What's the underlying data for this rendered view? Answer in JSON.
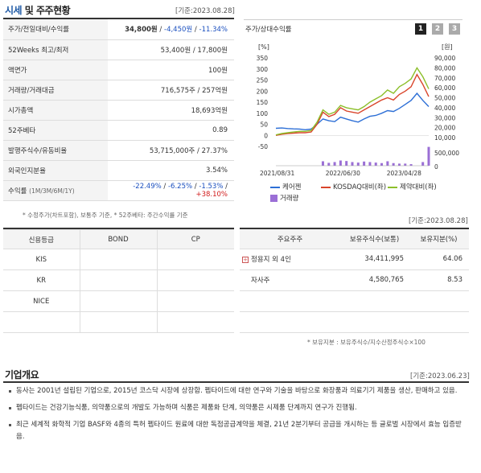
{
  "section1": {
    "title_accent": "시세",
    "title_rest": " 및 주주현황",
    "ref_date": "[기준:2023.08.28]"
  },
  "info": {
    "rows": [
      {
        "label": "주가/전일대비/수익률"
      },
      {
        "label": "52Weeks 최고/최저",
        "value": "53,400원 / 17,800원"
      },
      {
        "label": "액면가",
        "value": "100원"
      },
      {
        "label": "거래량/거래대금",
        "value": "716,575주 / 257억원"
      },
      {
        "label": "시가총액",
        "value": "18,693억원"
      },
      {
        "label": "52주베타",
        "value": "0.89"
      },
      {
        "label": "발행주식수/유동비율",
        "value": "53,715,000주 / 27.37%"
      },
      {
        "label": "외국인지분율",
        "value": "3.54%"
      },
      {
        "label": "수익률",
        "label_sub": "(1M/3M/6M/1Y)"
      }
    ],
    "price": "34,800원",
    "sep": " / ",
    "change": "-4,450원",
    "change_pct": "-11.34%",
    "ret_1m": "-22.49%",
    "ret_3m": "-6.25%",
    "ret_6m": "-1.53%",
    "ret_1y": "+38.10%",
    "footnote": "* 수정주가(차트포함), 보통주 기준, * 52주베타: 주간수익률 기준"
  },
  "chart_panel": {
    "title": "주가/상대수익률",
    "tabs": [
      "1",
      "2",
      "3"
    ],
    "active_tab": "1"
  },
  "chart_data": {
    "type": "line",
    "left_axis_unit": "[%]",
    "right_axis_unit": "[원]",
    "left_ticks": [
      "350",
      "300",
      "250",
      "200",
      "150",
      "100",
      "50",
      "0",
      "-50"
    ],
    "right_ticks": [
      "90,000",
      "80,000",
      "70,000",
      "60,000",
      "50,000",
      "40,000",
      "30,000",
      "20,000",
      "10,000"
    ],
    "volume_tick": "500,000",
    "volume_zero": "0",
    "x_labels": [
      "2021/08/31",
      "2022/06/30",
      "2023/04/28"
    ],
    "ylim_left": [
      -50,
      350
    ],
    "ylim_right": [
      0,
      90000
    ],
    "series": [
      {
        "name": "케어젠",
        "color": "#2d6fd6",
        "axis": "right",
        "values": [
          10500,
          10800,
          10200,
          9800,
          9600,
          8800,
          9600,
          15000,
          21000,
          19000,
          18000,
          23000,
          21000,
          19000,
          17500,
          21000,
          24000,
          25000,
          27500,
          30500,
          29500,
          33000,
          37500,
          42000,
          50000,
          42000,
          35000
        ]
      },
      {
        "name": "KOSDAQ대비(좌)",
        "color": "#d9452b",
        "axis": "left",
        "values": [
          0,
          5,
          8,
          10,
          12,
          12,
          15,
          50,
          105,
          85,
          95,
          125,
          110,
          105,
          100,
          115,
          130,
          145,
          160,
          170,
          160,
          185,
          200,
          220,
          275,
          230,
          175
        ]
      },
      {
        "name": "제약대비(좌)",
        "color": "#8cbf2a",
        "axis": "left",
        "values": [
          2,
          8,
          12,
          15,
          18,
          18,
          22,
          60,
          115,
          95,
          105,
          135,
          125,
          120,
          115,
          130,
          150,
          165,
          180,
          205,
          190,
          220,
          235,
          255,
          305,
          265,
          210
        ]
      }
    ],
    "volume": {
      "name": "거래량",
      "color": "#9b6fd6",
      "values": [
        0,
        0,
        0,
        0,
        0,
        0,
        0,
        0,
        170000,
        110000,
        140000,
        200000,
        180000,
        140000,
        120000,
        160000,
        140000,
        120000,
        100000,
        170000,
        100000,
        80000,
        80000,
        60000,
        0,
        140000,
        720000
      ]
    },
    "volume_max": 800000
  },
  "credit": {
    "ref_date": "[기준:2023.08.28]",
    "headers": [
      "신용등급",
      "BOND",
      "CP"
    ],
    "rows": [
      {
        "agency": "KIS",
        "bond": "",
        "cp": ""
      },
      {
        "agency": "KR",
        "bond": "",
        "cp": ""
      },
      {
        "agency": "NICE",
        "bond": "",
        "cp": ""
      }
    ]
  },
  "shareholders": {
    "headers": [
      "주요주주",
      "보유주식수(보통)",
      "보유지분(%)"
    ],
    "rows": [
      {
        "name": "정용지 외 4인",
        "shares": "34,411,995",
        "pct": "64.06"
      },
      {
        "name": "자사주",
        "shares": "4,580,765",
        "pct": "8.53"
      }
    ],
    "footnote": "* 보유지분 : 보유주식수/지수산정주식수×100"
  },
  "overview": {
    "title": "기업개요",
    "ref_date": "[기준:2023.06.23]",
    "items": [
      "동사는 2001년 설립된 기업으로, 2015년 코스닥 시장에 상장함. 펩타이드에 대한 연구와 기술을 바탕으로 화장품과 의료기기 제품을 생산, 판매하고 있음.",
      "펩타이드는 건강기능식품, 의약품으로의 개발도 가능하며 식품은 제품화 단계, 의약품은 시제품 단계까지 연구가 진행됨.",
      "최근 세계적 화학적 기업 BASF와 4종의 특허 펩타이드 원료에 대한 독점공급계약을 체결, 21년 2분기부터 공급을 개시하는 등 글로벌 시장에서 효능 입증받음."
    ]
  }
}
